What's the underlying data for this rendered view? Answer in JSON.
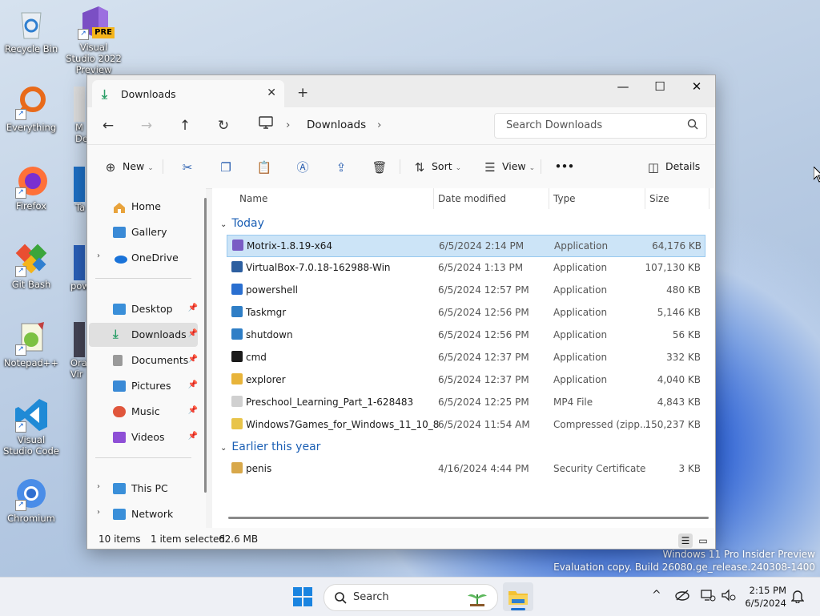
{
  "desktop": {
    "icons": [
      {
        "label": "Recycle Bin"
      },
      {
        "label": "Visual Studio 2022 Preview",
        "badge": "PRE"
      },
      {
        "label": "Everything"
      },
      {
        "label": "Firefox"
      },
      {
        "label": "Git Bash"
      },
      {
        "label": "Notepad++"
      },
      {
        "label": "Visual Studio Code"
      },
      {
        "label": "Chromium"
      },
      {
        "label": "M De"
      },
      {
        "label": "Ta"
      },
      {
        "label": "pow"
      },
      {
        "label": "Ora Vir"
      }
    ],
    "watermark_line1": "Windows 11 Pro Insider Preview",
    "watermark_line2": "Evaluation copy. Build 26080.ge_release.240308-1400"
  },
  "explorer": {
    "tab_title": "Downloads",
    "tab_close": "✕",
    "new_tab": "+",
    "controls": {
      "minimize": "—",
      "maximize": "☐",
      "close": "✕"
    },
    "nav": {
      "back": "←",
      "forward": "→",
      "up": "↑",
      "refresh": "↻"
    },
    "breadcrumb": {
      "sep1": "›",
      "current": "Downloads",
      "sep2": "›"
    },
    "search_placeholder": "Search Downloads",
    "commands": {
      "new": "New",
      "sort": "Sort",
      "view": "View",
      "more": "•••",
      "details": "Details"
    },
    "sidebar": {
      "items": [
        {
          "label": "Home",
          "color": "#e8a33c"
        },
        {
          "label": "Gallery",
          "color": "#3a8ad6"
        },
        {
          "label": "OneDrive",
          "color": "#1a73d9",
          "expand": "›"
        },
        {
          "label": "Desktop",
          "color": "#3a8fd9",
          "pin": "📌"
        },
        {
          "label": "Downloads",
          "color": "#2ea06a",
          "pin": "📌"
        },
        {
          "label": "Documents",
          "color": "#8a8a8a",
          "pin": "📌"
        },
        {
          "label": "Pictures",
          "color": "#3a8ad6",
          "pin": "📌"
        },
        {
          "label": "Music",
          "color": "#e0563c",
          "pin": "📌"
        },
        {
          "label": "Videos",
          "color": "#8e4fd6",
          "pin": "📌"
        },
        {
          "label": "This PC",
          "color": "#3a8fd9",
          "expand": "›"
        },
        {
          "label": "Network",
          "color": "#3a8fd9",
          "expand": "›"
        }
      ]
    },
    "columns": {
      "name": "Name",
      "date": "Date modified",
      "type": "Type",
      "size": "Size"
    },
    "groups": {
      "today": "Today",
      "earlier": "Earlier this year"
    },
    "files_today": [
      {
        "name": "Motrix-1.8.19-x64",
        "date": "6/5/2024 2:14 PM",
        "type": "Application",
        "size": "64,176 KB",
        "color": "#7a5cc4"
      },
      {
        "name": "VirtualBox-7.0.18-162988-Win",
        "date": "6/5/2024 1:13 PM",
        "type": "Application",
        "size": "107,130 KB",
        "color": "#2d5fa0"
      },
      {
        "name": "powershell",
        "date": "6/5/2024 12:57 PM",
        "type": "Application",
        "size": "480 KB",
        "color": "#2a6fd0"
      },
      {
        "name": "Taskmgr",
        "date": "6/5/2024 12:56 PM",
        "type": "Application",
        "size": "5,146 KB",
        "color": "#2f7ec6"
      },
      {
        "name": "shutdown",
        "date": "6/5/2024 12:56 PM",
        "type": "Application",
        "size": "56 KB",
        "color": "#2f7ec6"
      },
      {
        "name": "cmd",
        "date": "6/5/2024 12:37 PM",
        "type": "Application",
        "size": "332 KB",
        "color": "#1a1a1a"
      },
      {
        "name": "explorer",
        "date": "6/5/2024 12:37 PM",
        "type": "Application",
        "size": "4,040 KB",
        "color": "#e8b43a"
      },
      {
        "name": "Preschool_Learning_Part_1-628483",
        "date": "6/5/2024 12:25 PM",
        "type": "MP4 File",
        "size": "4,843 KB",
        "color": "#d0d0d0"
      },
      {
        "name": "Windows7Games_for_Windows_11_10_8",
        "date": "6/5/2024 11:54 AM",
        "type": "Compressed (zipp...",
        "size": "150,237 KB",
        "color": "#e8c44a"
      }
    ],
    "files_earlier": [
      {
        "name": "penis",
        "date": "4/16/2024 4:44 PM",
        "type": "Security Certificate",
        "size": "3 KB",
        "color": "#d8a84a"
      }
    ],
    "status": {
      "count": "10 items",
      "selected": "1 item selected",
      "size": "62.6 MB"
    }
  },
  "taskbar": {
    "search_placeholder": "Search",
    "time": "2:15 PM",
    "date": "6/5/2024",
    "chevron": "^"
  }
}
